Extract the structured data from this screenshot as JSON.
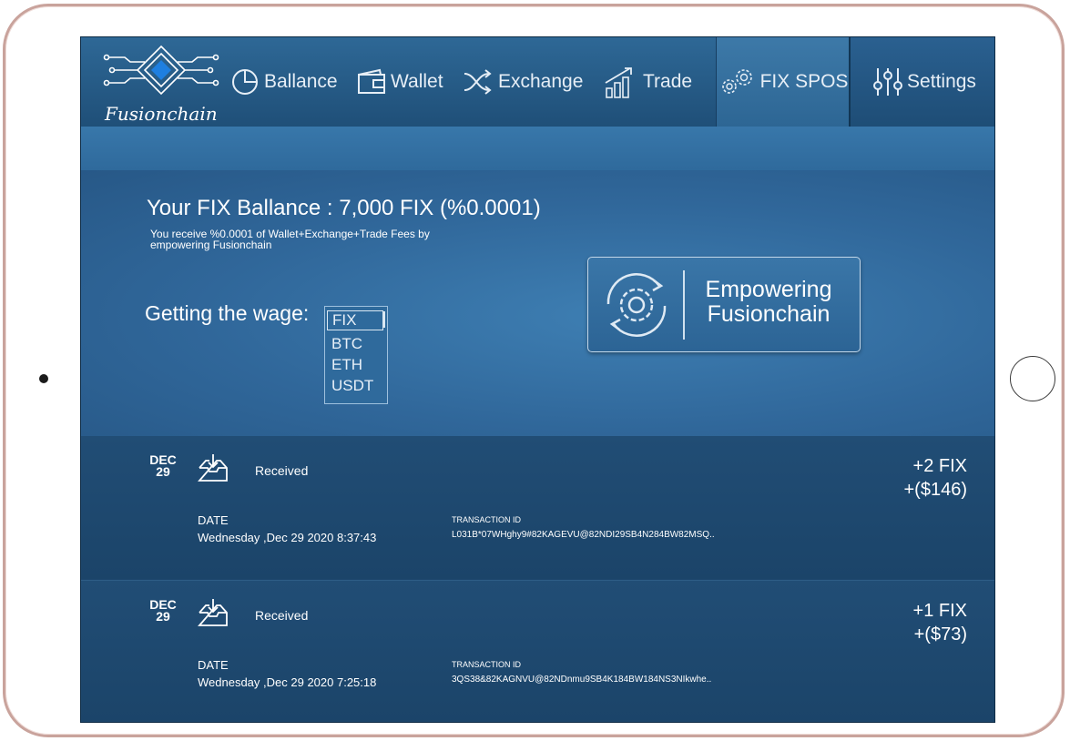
{
  "app": {
    "logo_text": "Fusionchain"
  },
  "nav": {
    "tabs": [
      {
        "label": "Ballance",
        "icon": "pie-chart-icon"
      },
      {
        "label": "Wallet",
        "icon": "wallet-icon"
      },
      {
        "label": "Exchange",
        "icon": "shuffle-icon"
      },
      {
        "label": "Trade",
        "icon": "bar-chart-icon"
      },
      {
        "label": "FIX SPOS",
        "icon": "gears-icon",
        "active": true
      },
      {
        "label": "Settings",
        "icon": "sliders-icon"
      }
    ]
  },
  "balance": {
    "title": "Your FIX Ballance : 7,000 FIX (%0.0001)",
    "description": "You receive %0.0001 of Wallet+Exchange+Trade Fees by empowering Fusionchain"
  },
  "wage": {
    "label": "Getting the wage:",
    "options": [
      "FIX",
      "BTC",
      "ETH",
      "USDT"
    ],
    "selected": "FIX"
  },
  "empower_button": {
    "line1": "Empowering",
    "line2": "Fusionchain"
  },
  "transactions": [
    {
      "month": "DEC",
      "day": "29",
      "status": "Received",
      "amount": "+2 FIX",
      "amount_usd": "+($146)",
      "date_label": "DATE",
      "date": "Wednesday ,Dec 29 2020 8:37:43",
      "tx_label": "TRANSACTION ID",
      "tx_id": "L031B*07WHghy9#82KAGEVU@82NDI29SB4N284BW82MSQ.."
    },
    {
      "month": "DEC",
      "day": "29",
      "status": "Received",
      "amount": "+1 FIX",
      "amount_usd": "+($73)",
      "date_label": "DATE",
      "date": "Wednesday ,Dec 29 2020 7:25:18",
      "tx_label": "TRANSACTION ID",
      "tx_id": "3QS38&82KAGNVU@82NDnmu9SB4K184BW184NS3NIkwhe.."
    }
  ],
  "colors": {
    "primary": "#2a5f8e",
    "dark": "#1d466c",
    "text": "#ffffff",
    "frame": "#c9a39c"
  }
}
